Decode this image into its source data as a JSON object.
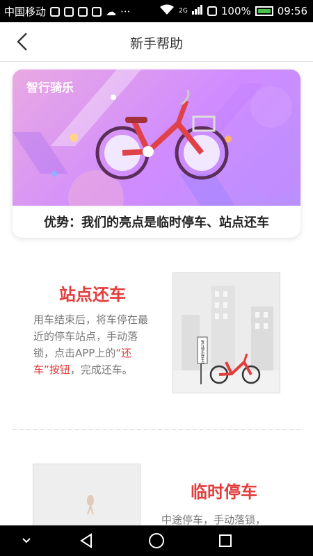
{
  "status_bar": {
    "carrier": "中国移动",
    "network": "2G",
    "battery": "100%",
    "time": "09:56"
  },
  "header": {
    "title": "新手帮助"
  },
  "banner": {
    "brand": "智行骑乐",
    "caption": "优势：我们的亮点是临时停车、站点还车"
  },
  "section_station": {
    "title": "站点还车",
    "desc_before": "用车结束后，将车停在最近的停车站点，手动落锁，点击APP上的",
    "desc_highlight": "“还车”按钮",
    "desc_after": "，完成还车。",
    "sign_text": "智行骑乐停车点"
  },
  "section_temp": {
    "title": "临时停车",
    "desc": "中途停车，手动落锁，"
  },
  "colors": {
    "accent": "#e23c3c",
    "banner_gradient": "#d08cff"
  }
}
